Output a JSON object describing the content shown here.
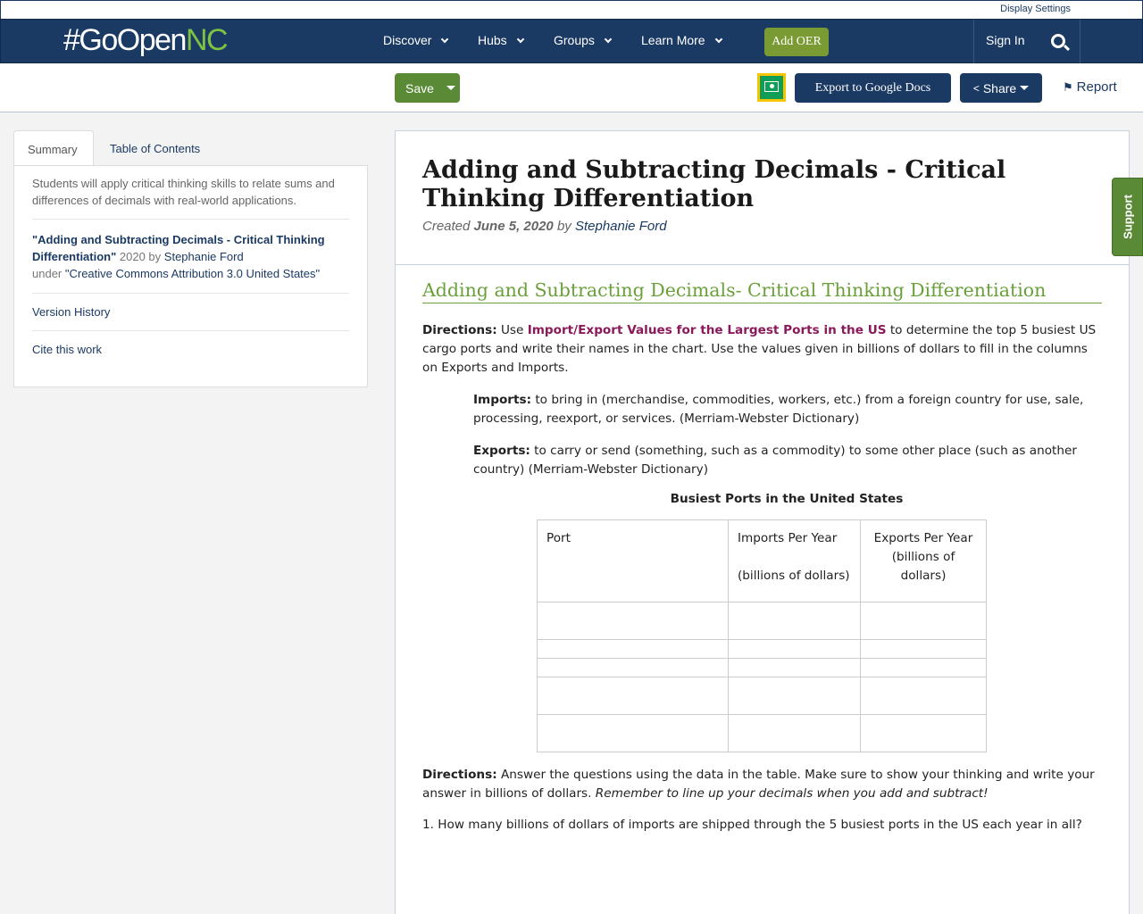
{
  "util": {
    "display_settings": "Display Settings"
  },
  "nav": {
    "logo_main": "#GoOpen",
    "logo_accent": "NC",
    "items": [
      "Discover",
      "Hubs",
      "Groups",
      "Learn More"
    ],
    "add_oer": "Add OER",
    "sign_in": "Sign In"
  },
  "toolbar": {
    "save": "Save",
    "export": "Export to Google Docs",
    "share": "Share",
    "report": "Report"
  },
  "sidebar": {
    "tabs": [
      "Summary",
      "Table of Contents"
    ],
    "summary": "Students will apply critical thinking skills to relate sums and differences of decimals with real-world applications.",
    "attrib_title": "\"Adding and Subtracting Decimals - Critical Thinking Differentiation\"",
    "attrib_year_by": " 2020 by ",
    "attrib_author": "Stephanie Ford",
    "attrib_under": "under ",
    "attrib_license": "\"Creative Commons Attribution 3.0 United States\"",
    "version_history": "Version History",
    "cite": "Cite this work"
  },
  "main": {
    "title": "Adding and Subtracting Decimals - Critical Thinking Differentiation",
    "created_label": "Created ",
    "created_date": "June 5, 2020",
    "by": " by ",
    "author": "Stephanie Ford",
    "subtitle": "Adding and Subtracting Decimals- Critical Thinking Differentiation",
    "dir1_label": "Directions:",
    "dir1_use": " Use ",
    "dir1_link": "Import/Export Values for the Largest Ports in the US",
    "dir1_rest": " to determine the top 5 busiest US cargo ports and write their names in the chart.  Use the values given in billions of dollars to fill in the columns on Exports and Imports.",
    "imports_label": "Imports:",
    "imports_def": " to bring in (merchandise, commodities, workers, etc.) from a foreign country for use, sale, processing, reexport, or services. (Merriam-Webster Dictionary)",
    "exports_label": "Exports:",
    "exports_def": "  to carry or send (something, such as a commodity) to some other place (such as another country) (Merriam-Webster Dictionary)",
    "table_title": "Busiest Ports in the United States",
    "table_headers": {
      "port": "Port",
      "imports": "Imports Per Year",
      "imports_unit": "(billions of dollars)",
      "exports": "Exports Per Year (billions of dollars)"
    },
    "dir2_label": "Directions:",
    "dir2_text": "  Answer the questions using the data in the table.  Make sure to show your thinking and write your answer in billions of dollars.  ",
    "dir2_italic": "Remember to line up your decimals when you add and subtract!",
    "question1": "1. How many billions of dollars of imports  are shipped through the 5 busiest ports in the US each year in all?"
  },
  "support": "Support"
}
